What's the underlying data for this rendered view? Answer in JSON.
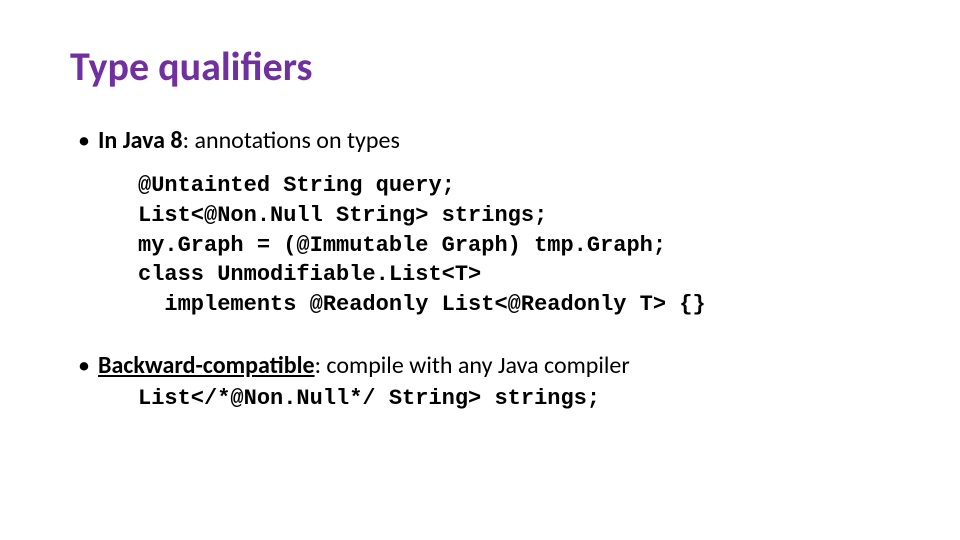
{
  "title": "Type qualifiers",
  "bullet1": {
    "lead": "In Java 8",
    "rest": ":  annotations on types"
  },
  "code": {
    "l1": "@Untainted String query;",
    "l2": "List<@Non.Null String> strings;",
    "l3": "my.Graph = (@Immutable Graph) tmp.Graph;",
    "l4": "class Unmodifiable.List<T>",
    "l5": "  implements @Readonly List<@Readonly T> {}"
  },
  "bullet2": {
    "lead": "Backward-compatible",
    "rest": ":  compile with any Java compiler"
  },
  "code2": "List</*@Non.Null*/ String> strings;"
}
